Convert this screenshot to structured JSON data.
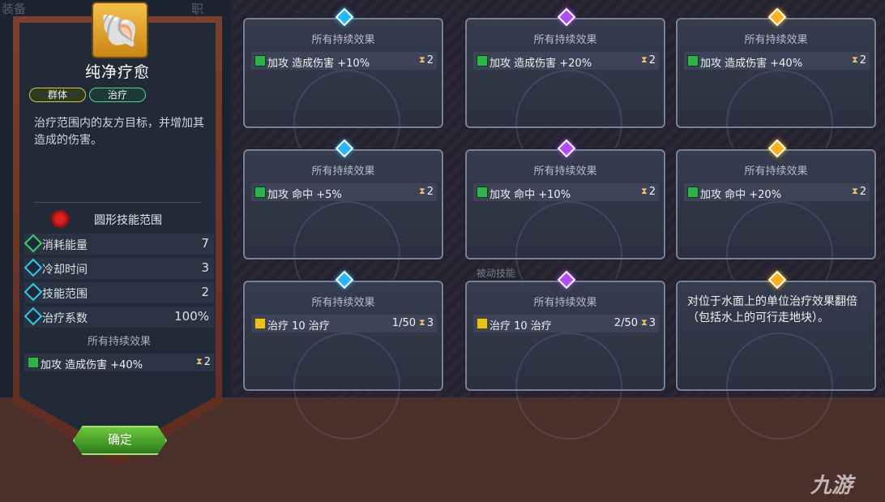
{
  "side_ghost_left": "装备",
  "side_ghost_right": "职",
  "skill": {
    "icon": "shell-icon",
    "name": "纯净疗愈",
    "tags": [
      "群体",
      "治疗"
    ],
    "description": "治疗范围内的友方目标，并增加其造成的伤害。",
    "range_label": "圆形技能范围",
    "stats": [
      {
        "label": "消耗能量",
        "value": "7"
      },
      {
        "label": "冷却时间",
        "value": "3"
      },
      {
        "label": "技能范围",
        "value": "2"
      },
      {
        "label": "治疗系数",
        "value": "100%"
      }
    ],
    "effects_header": "所有持续效果",
    "effect": {
      "text": "加攻 造成伤害 +40%",
      "turns": "2"
    },
    "confirm_label": "确定"
  },
  "passive_label": "被动技能",
  "cards": [
    {
      "gem_color": "#26b8ff",
      "title": "所有持续效果",
      "type": "attack",
      "text": "加攻 造成伤害 +10%",
      "count": "",
      "turns": "2"
    },
    {
      "gem_color": "#b04cff",
      "title": "所有持续效果",
      "type": "attack",
      "text": "加攻 造成伤害 +20%",
      "count": "",
      "turns": "2"
    },
    {
      "gem_color": "#ffb21c",
      "title": "所有持续效果",
      "type": "attack",
      "text": "加攻 造成伤害 +40%",
      "count": "",
      "turns": "2"
    },
    {
      "gem_color": "#26b8ff",
      "title": "所有持续效果",
      "type": "attack",
      "text": "加攻 命中 +5%",
      "count": "",
      "turns": "2"
    },
    {
      "gem_color": "#b04cff",
      "title": "所有持续效果",
      "type": "attack",
      "text": "加攻 命中 +10%",
      "count": "",
      "turns": "2"
    },
    {
      "gem_color": "#ffb21c",
      "title": "所有持续效果",
      "type": "attack",
      "text": "加攻 命中 +20%",
      "count": "",
      "turns": "2"
    },
    {
      "gem_color": "#26b8ff",
      "title": "所有持续效果",
      "type": "heal",
      "text": "治疗 10 治疗",
      "count": "1/50",
      "turns": "3"
    },
    {
      "gem_color": "#b04cff",
      "title": "所有持续效果",
      "type": "heal",
      "text": "治疗 10 治疗",
      "count": "2/50",
      "turns": "3"
    },
    {
      "gem_color": "#ffb21c",
      "note": "对位于水面上的单位治疗效果翻倍（包括水上的可行走地块）。"
    }
  ],
  "watermark": "九游"
}
